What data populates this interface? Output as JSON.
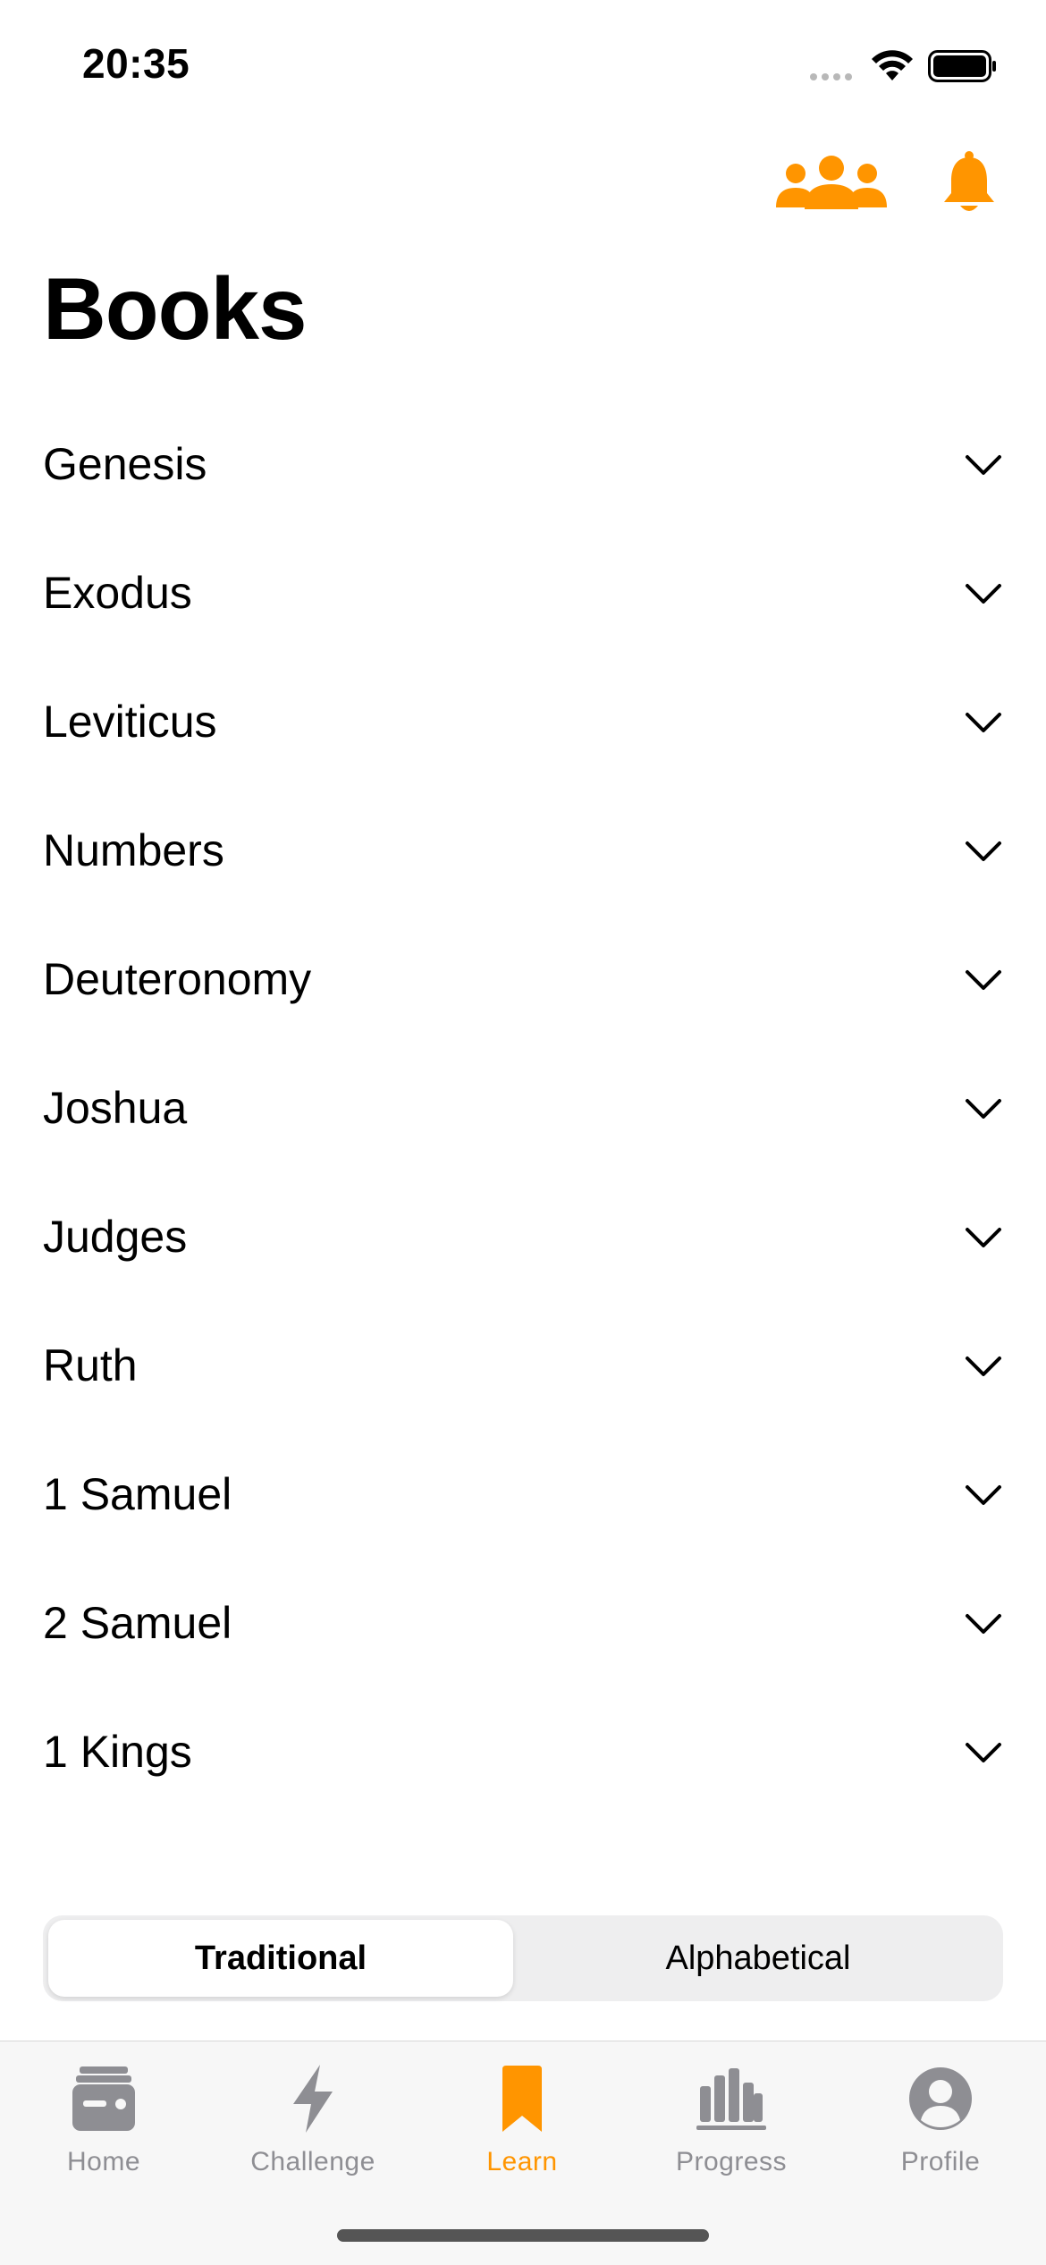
{
  "status_bar": {
    "time": "20:35"
  },
  "colors": {
    "accent": "#FF9500",
    "inactive": "#8E8E93",
    "segment_bg": "#EEEEEF"
  },
  "header": {
    "title": "Books",
    "actions": [
      {
        "icon": "people-icon"
      },
      {
        "icon": "bell-icon"
      }
    ]
  },
  "books": [
    {
      "label": "Genesis"
    },
    {
      "label": "Exodus"
    },
    {
      "label": "Leviticus"
    },
    {
      "label": "Numbers"
    },
    {
      "label": "Deuteronomy"
    },
    {
      "label": "Joshua"
    },
    {
      "label": "Judges"
    },
    {
      "label": "Ruth"
    },
    {
      "label": "1 Samuel"
    },
    {
      "label": "2 Samuel"
    },
    {
      "label": "1 Kings"
    }
  ],
  "sort_control": {
    "options": [
      "Traditional",
      "Alphabetical"
    ],
    "selected": "Traditional"
  },
  "tab_bar": {
    "tabs": [
      {
        "label": "Home",
        "icon": "wallet-icon"
      },
      {
        "label": "Challenge",
        "icon": "bolt-icon"
      },
      {
        "label": "Learn",
        "icon": "bookmark-icon"
      },
      {
        "label": "Progress",
        "icon": "bar-chart-icon"
      },
      {
        "label": "Profile",
        "icon": "person-circle-icon"
      }
    ],
    "selected": "Learn"
  }
}
